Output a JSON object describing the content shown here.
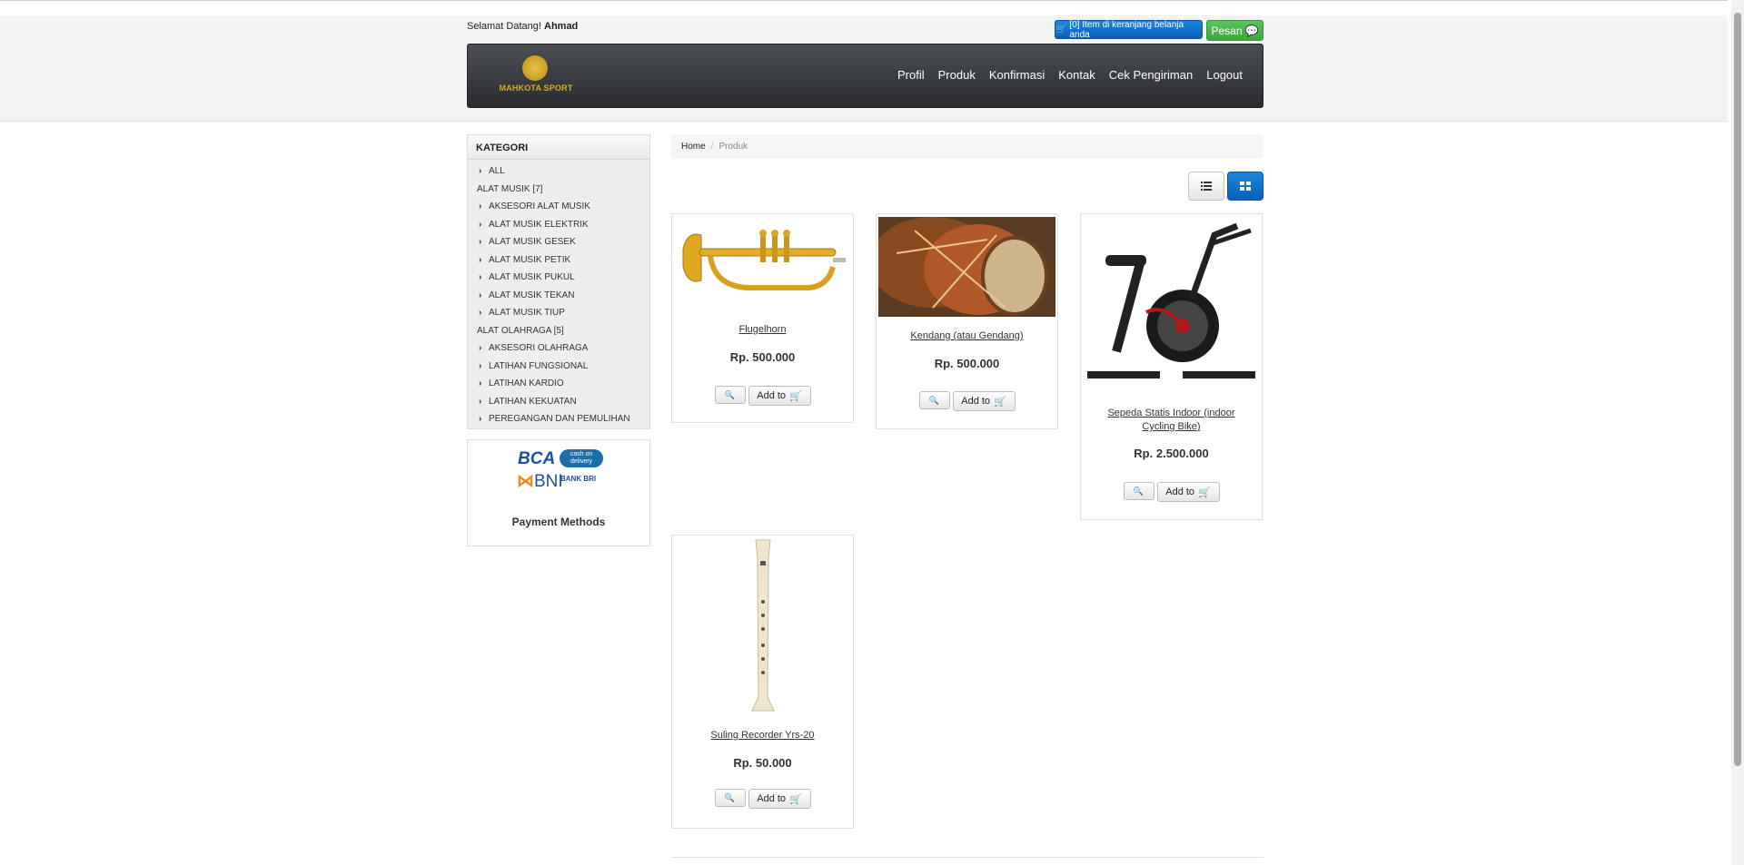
{
  "header": {
    "welcome_prefix": "Selamat Datang!",
    "user_name": "Ahmad",
    "cart_label": "[0] Item di keranjang belanja anda",
    "pesan_label": "Pesan"
  },
  "brand": {
    "logo_text": "MAHKOTA SPORT",
    "accent_color": "#d8ac2a"
  },
  "nav": {
    "items": [
      "Profil",
      "Produk",
      "Konfirmasi",
      "Kontak",
      "Cek Pengiriman",
      "Logout"
    ]
  },
  "sidebar": {
    "title": "KATEGORI",
    "all_label": "ALL",
    "group1": {
      "label": "ALAT MUSIK [7]",
      "items": [
        "AKSESORI ALAT MUSIK",
        "ALAT MUSIK ELEKTRIK",
        "ALAT MUSIK GESEK",
        "ALAT MUSIK PETIK",
        "ALAT MUSIK PUKUL",
        "ALAT MUSIK TEKAN",
        "ALAT MUSIK TIUP"
      ]
    },
    "group2": {
      "label": "ALAT OLAHRAGA [5]",
      "items": [
        "AKSESORI OLAHRAGA",
        "LATIHAN FUNGSIONAL",
        "LATIHAN KARDIO",
        "LATIHAN KEKUATAN",
        "PEREGANGAN DAN PEMULIHAN"
      ]
    }
  },
  "payment": {
    "bca": "BCA",
    "cod": "cash on delivery",
    "bni": "BNI",
    "bri": "BANK BRI",
    "caption": "Payment Methods"
  },
  "breadcrumb": {
    "home": "Home",
    "separator": "/",
    "current": "Produk"
  },
  "products": [
    {
      "name": "Flugelhorn",
      "price": "Rp. 500.000",
      "add_label": "Add to"
    },
    {
      "name": "Kendang (atau Gendang)",
      "price": "Rp. 500.000",
      "add_label": "Add to"
    },
    {
      "name": "Sepeda Statis Indoor (indoor Cycling Bike)",
      "price": "Rp. 2.500.000",
      "add_label": "Add to"
    },
    {
      "name": "Suling Recorder Yrs-20",
      "price": "Rp. 50.000",
      "add_label": "Add to"
    }
  ],
  "colors": {
    "primary_blue": "#0a6fd0",
    "success_green": "#4cb74c",
    "navbar_dark": "#3a3d41"
  }
}
